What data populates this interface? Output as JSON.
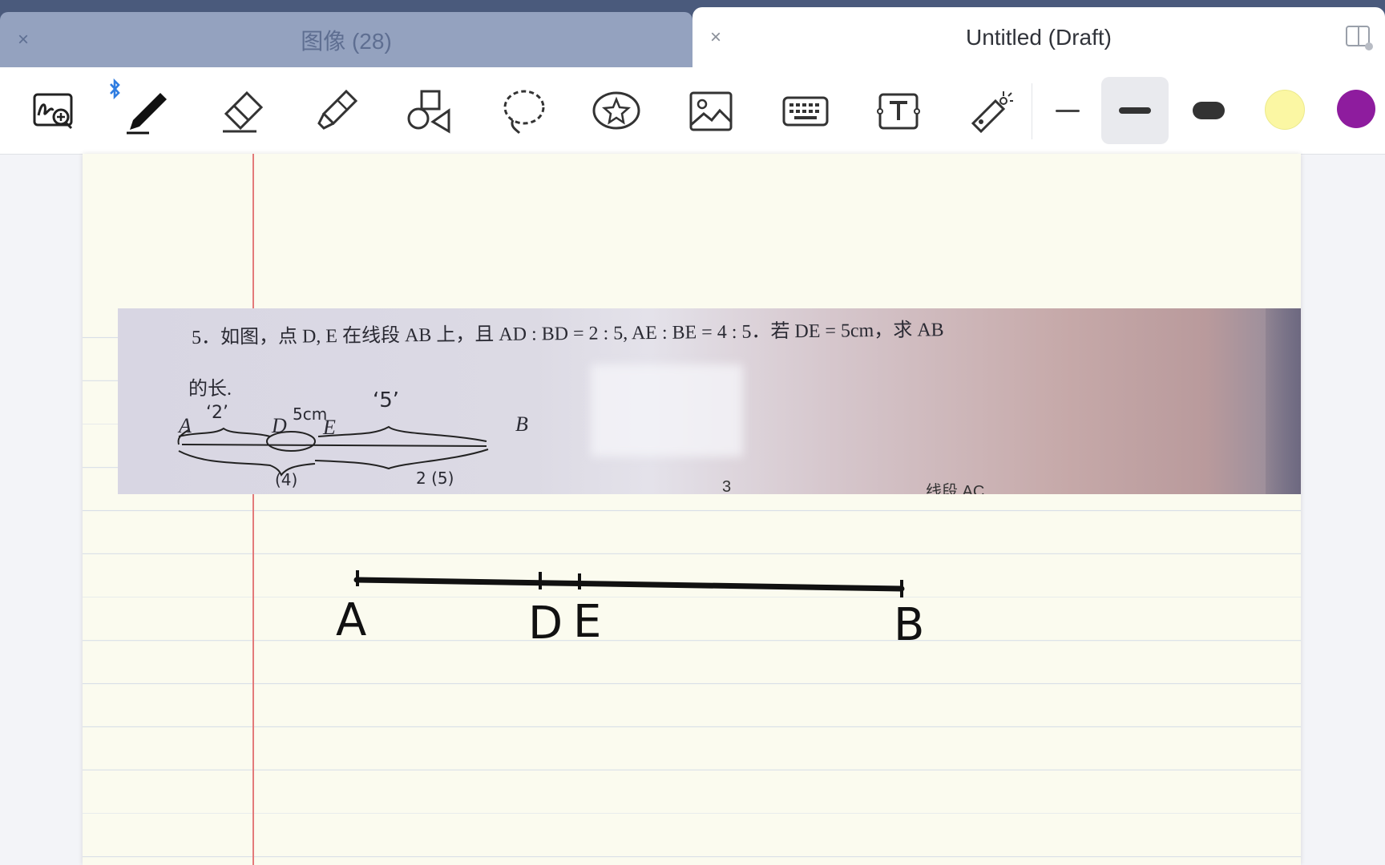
{
  "tabs": [
    {
      "title": "图像 (28)",
      "active": false
    },
    {
      "title": "Untitled (Draft)",
      "active": true
    }
  ],
  "tab_close_glyph": "×",
  "toolbar": {
    "tools": [
      "zoom-window-icon",
      "pen-icon",
      "eraser-icon",
      "highlighter-icon",
      "shapes-icon",
      "lasso-icon",
      "elements-icon",
      "image-icon",
      "keyboard-icon",
      "text-box-icon",
      "laser-pointer-icon"
    ],
    "bluetooth_indicator": "bluetooth-icon",
    "stroke_sizes": [
      "thin",
      "medium",
      "thick"
    ],
    "selected_stroke": "medium",
    "colors": [
      "#fbf7a3",
      "#8e1c9e"
    ]
  },
  "photo": {
    "line1": "5．如图，点 D, E 在线段 AB 上，且 AD : BD = 2 : 5, AE : BE = 4 : 5．若 DE = 5cm，求 AB",
    "line2": "的长.",
    "sketch_labels": {
      "A": "A",
      "D": "D",
      "E": "E",
      "B": "B"
    },
    "handwriting": {
      "two": "‘2’",
      "five_cm": "5cm",
      "five": "‘5’",
      "four": "(4)",
      "seven_five": "2 (5)"
    },
    "partial_text": {
      "left": "3",
      "right": "…线段 AC"
    }
  },
  "drawing": {
    "points": [
      "A",
      "D",
      "E",
      "B"
    ]
  }
}
